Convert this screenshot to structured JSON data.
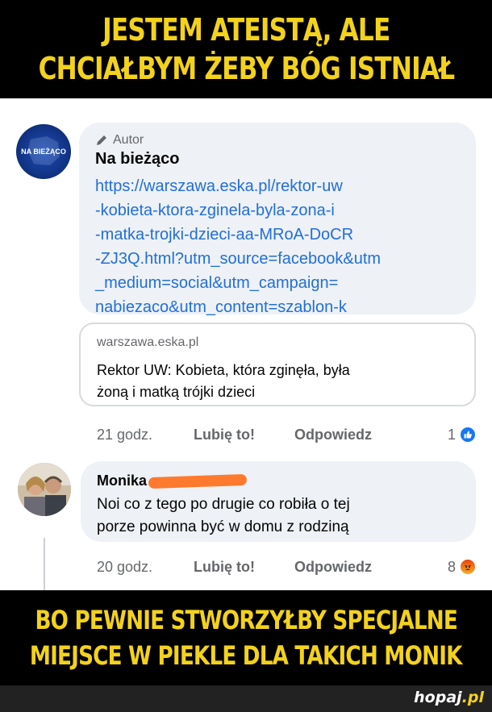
{
  "meme": {
    "top_line_1": "JESTEM ATEISTĄ, ALE",
    "top_line_2": "CHCIAŁBYM ŻEBY BÓG ISTNIAŁ",
    "bottom_line_1": "BO PEWNIE STWORZYŁBY SPECJALNE",
    "bottom_line_2": "MIEJSCE W PIEKLE DLA TAKICH MONIK"
  },
  "post_comment": {
    "author_tag": "Autor",
    "page_name": "Na bieżąco",
    "avatar_logo": "NA BIEŻĄCO",
    "link": "https://warszawa.eska.pl/rektor-uw\n-kobieta-ktora-zginela-byla-zona-i\n-matka-trojki-dzieci-aa-MRoA-DoCR\n-ZJ3Q.html?utm_source=facebook&utm\n_medium=social&utm_campaign=\nnabiezaco&utm_content=szablon-k",
    "preview": {
      "domain": "warszawa.eska.pl",
      "title": "Rektor UW: Kobieta, która zginęła, była\nżoną i matką trójki dzieci"
    },
    "actions": {
      "time": "21 godz.",
      "like": "Lubię to!",
      "reply": "Odpowiedz",
      "reaction_count": "1"
    }
  },
  "reply_comment": {
    "name": "Monika",
    "text": "Noi co z tego po drugie co robiła o tej\nporze powinna być w domu z rodziną",
    "actions": {
      "time": "20 godz.",
      "like": "Lubię to!",
      "reply": "Odpowiedz",
      "reaction_count": "8"
    }
  },
  "footer": {
    "logo_main": "hopaj",
    "logo_tld": ".pl"
  },
  "colors": {
    "meme_text": "#f3d21c",
    "link": "#216fdb",
    "bubble": "#eef1f5",
    "like_blue": "#1877f2",
    "redaction": "#ff7a2e"
  }
}
